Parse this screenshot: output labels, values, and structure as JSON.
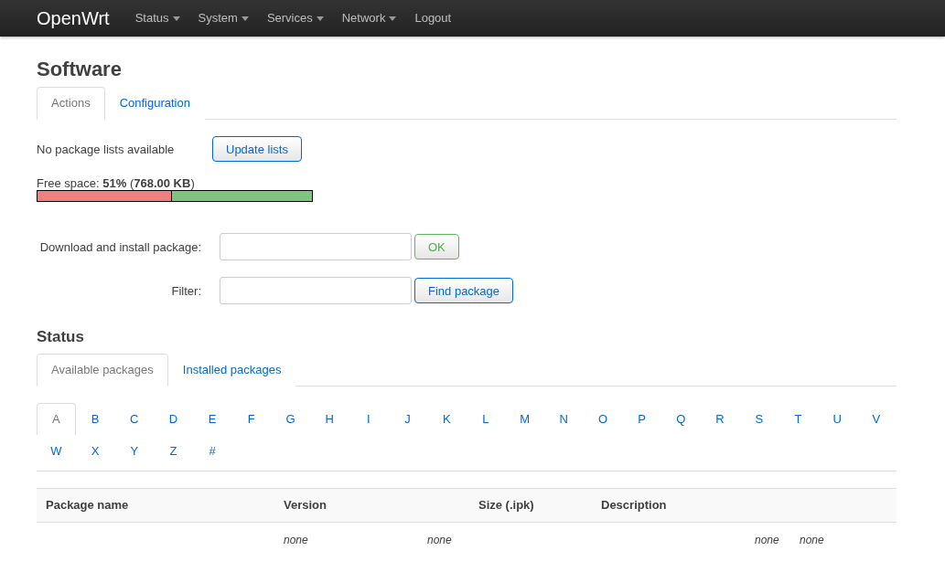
{
  "navbar": {
    "brand": "OpenWrt",
    "menu": [
      {
        "label": "Status",
        "dropdown": true
      },
      {
        "label": "System",
        "dropdown": true
      },
      {
        "label": "Services",
        "dropdown": true
      },
      {
        "label": "Network",
        "dropdown": true
      },
      {
        "label": "Logout",
        "dropdown": false
      }
    ]
  },
  "title": "Software",
  "tabs": [
    {
      "label": "Actions",
      "selected": true
    },
    {
      "label": "Configuration",
      "selected": false
    }
  ],
  "lists": {
    "message": "No package lists available",
    "button": "Update lists"
  },
  "free_space": {
    "label": "Free space: **51%** (**768.00 KB**)",
    "level": 0.49
  },
  "download": {
    "label": "Download and install package:",
    "button": "OK"
  },
  "filter": {
    "label": "Filter:",
    "button": "Find package"
  },
  "status_title": "Status",
  "status_tabs": [
    {
      "label": "Available packages",
      "selected": true
    },
    {
      "label": "Installed packages",
      "selected": false
    }
  ],
  "letters": [
    {
      "label": "A",
      "selected": true
    },
    {
      "label": "B",
      "selected": false
    },
    {
      "label": "C",
      "selected": false
    },
    {
      "label": "D",
      "selected": false
    },
    {
      "label": "E",
      "selected": false
    },
    {
      "label": "F",
      "selected": false
    },
    {
      "label": "G",
      "selected": false
    },
    {
      "label": "H",
      "selected": false
    },
    {
      "label": "I",
      "selected": false
    },
    {
      "label": "J",
      "selected": false
    },
    {
      "label": "K",
      "selected": false
    },
    {
      "label": "L",
      "selected": false
    },
    {
      "label": "M",
      "selected": false
    },
    {
      "label": "N",
      "selected": false
    },
    {
      "label": "O",
      "selected": false
    },
    {
      "label": "P",
      "selected": false
    },
    {
      "label": "Q",
      "selected": false
    },
    {
      "label": "R",
      "selected": false
    },
    {
      "label": "S",
      "selected": false
    },
    {
      "label": "T",
      "selected": false
    },
    {
      "label": "U",
      "selected": false
    },
    {
      "label": "V",
      "selected": false
    },
    {
      "label": "W",
      "selected": false
    },
    {
      "label": "X",
      "selected": false
    },
    {
      "label": "Y",
      "selected": false
    },
    {
      "label": "Z",
      "selected": false
    },
    {
      "label": "#",
      "selected": false
    }
  ],
  "table": {
    "columns": [
      "Package name",
      "Version",
      "Size (.ipk)",
      "Description"
    ],
    "rows": [
      [
        "",
        "none",
        "none",
        "none",
        "none"
      ]
    ]
  }
}
